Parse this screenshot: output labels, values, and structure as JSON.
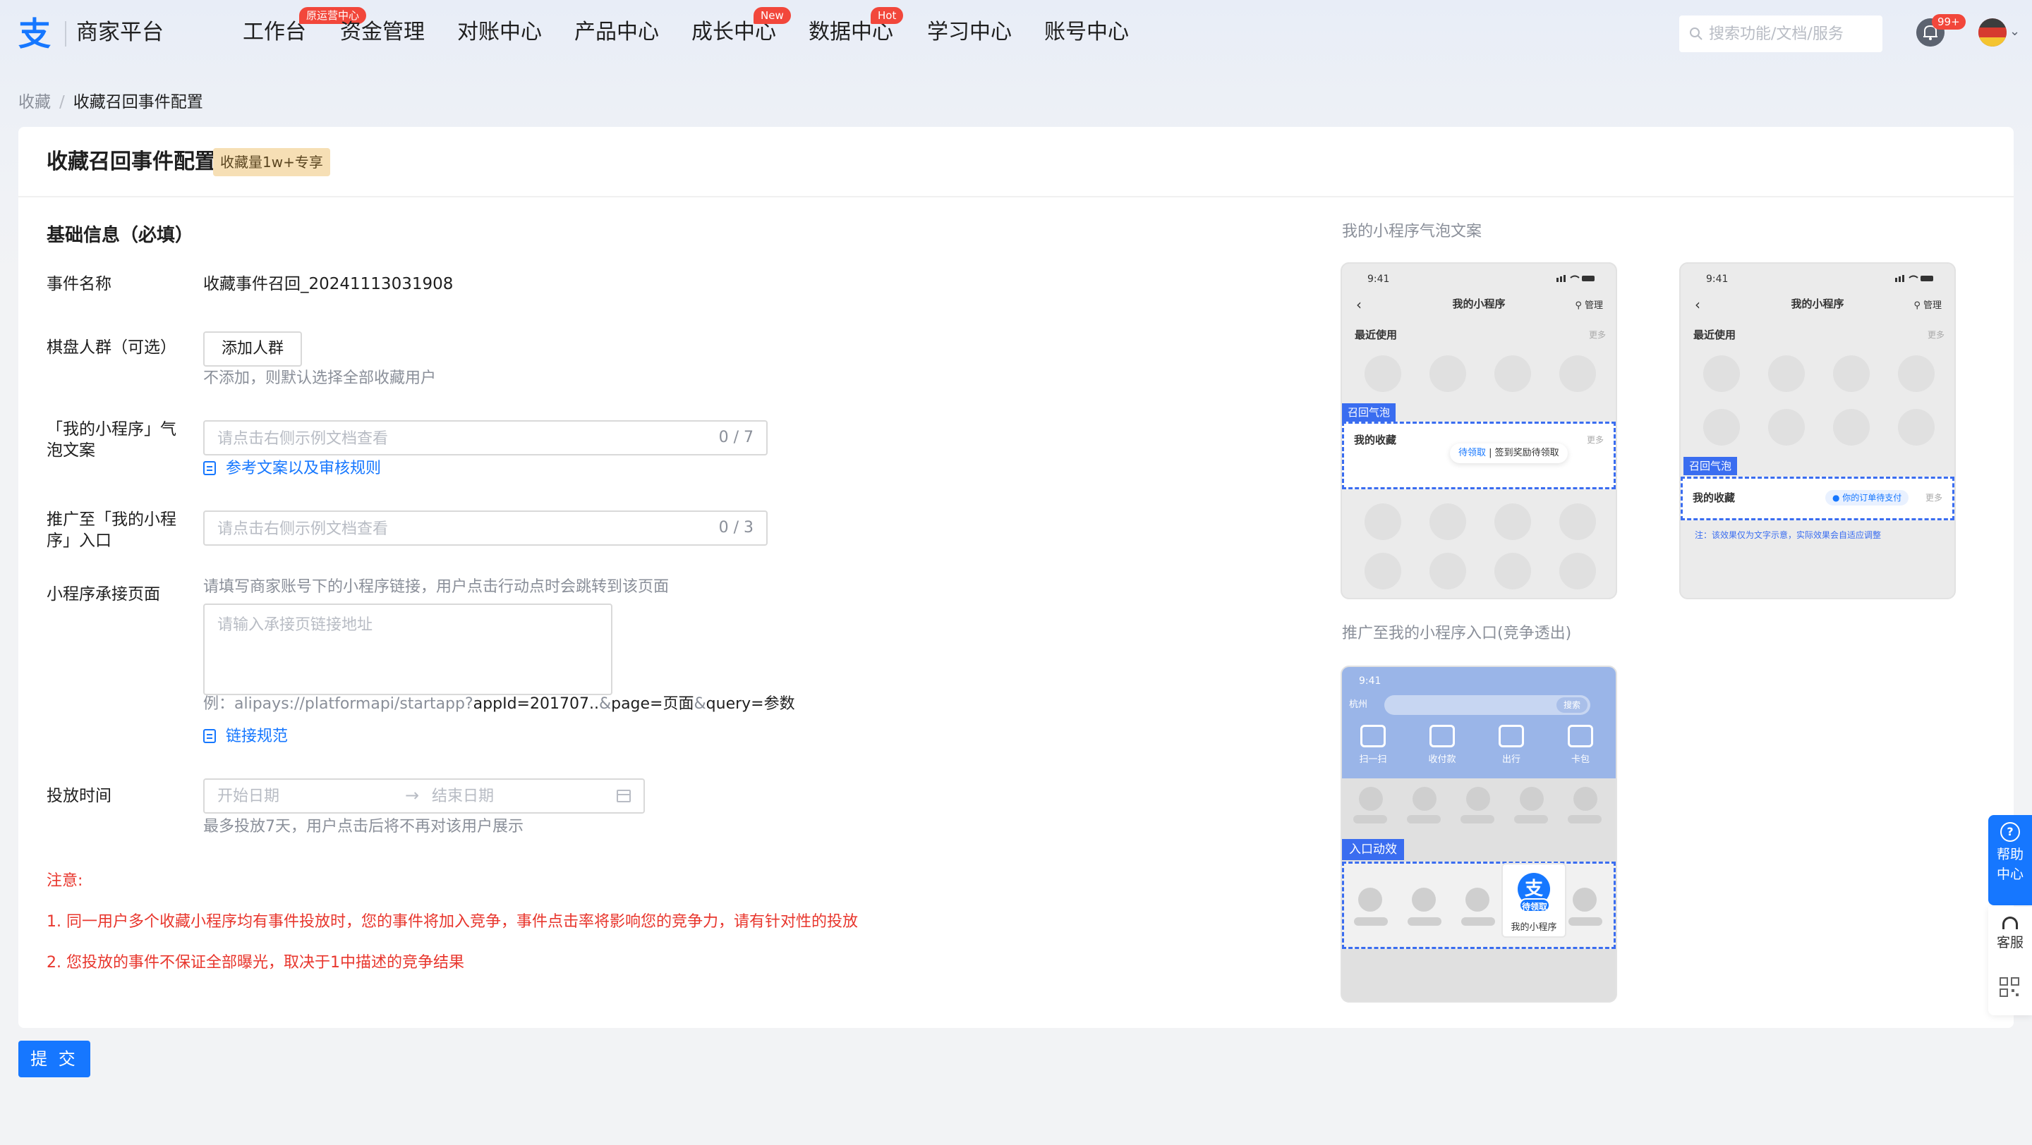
{
  "brand": {
    "name": "商家平台"
  },
  "nav": {
    "items": [
      {
        "label": "工作台",
        "badge": "原运营中心"
      },
      {
        "label": "资金管理",
        "badge": ""
      },
      {
        "label": "对账中心",
        "badge": ""
      },
      {
        "label": "产品中心",
        "badge": ""
      },
      {
        "label": "成长中心",
        "badge": "New"
      },
      {
        "label": "数据中心",
        "badge": "Hot"
      },
      {
        "label": "学习中心",
        "badge": ""
      },
      {
        "label": "账号中心",
        "badge": ""
      }
    ]
  },
  "header": {
    "search_placeholder": "搜索功能/文档/服务",
    "notification_count": "99+"
  },
  "breadcrumb": {
    "parent": "收藏",
    "separator": "/",
    "current": "收藏召回事件配置"
  },
  "page": {
    "title": "收藏召回事件配置",
    "tag": "收藏量1w+专享"
  },
  "form": {
    "section_title": "基础信息（必填）",
    "event_name": {
      "label": "事件名称",
      "value": "收藏事件召回_20241113031908"
    },
    "audience": {
      "label": "棋盘人群（可选）",
      "button": "添加人群",
      "hint": "不添加，则默认选择全部收藏用户"
    },
    "bubble_copy": {
      "label": "「我的小程序」气泡文案",
      "placeholder": "请点击右侧示例文档查看",
      "counter": "0 / 7",
      "link": "参考文案以及审核规则"
    },
    "promote_entry": {
      "label": "推广至「我的小程序」入口",
      "placeholder": "请点击右侧示例文档查看",
      "counter": "0 / 3"
    },
    "landing_page": {
      "label": "小程序承接页面",
      "hint": "请填写商家账号下的小程序链接，用户点击行动点时会跳转到该页面",
      "placeholder": "请输入承接页链接地址",
      "example_parts": [
        "例：",
        "alipays://platformapi/startapp?",
        "appId=201707..",
        "&",
        "page=页面",
        "&",
        "query=参数"
      ],
      "link": "链接规范"
    },
    "schedule": {
      "label": "投放时间",
      "start_placeholder": "开始日期",
      "end_placeholder": "结束日期",
      "hint": "最多投放7天，用户点击后将不再对该用户展示"
    },
    "notes": {
      "title": "注意:",
      "items": [
        "1. 同一用户多个收藏小程序均有事件投放时，您的事件将加入竞争，事件点击率将影响您的竞争力，请有针对性的投放",
        "2. 您投放的事件不保证全部曝光，取决于1中描述的竞争结果"
      ]
    },
    "submit_label": "提 交"
  },
  "preview": {
    "bubble_title": "我的小程序气泡文案",
    "entry_title": "推广至我的小程序入口(竞争透出)",
    "phone": {
      "time": "9:41",
      "title": "我的小程序",
      "manage": "管理",
      "recent": "最近使用",
      "more": "更多",
      "recall_tag": "召回气泡",
      "favorites": "我的收藏",
      "bubble_claim": "待领取",
      "bubble_text": "签到奖励待领取",
      "chip_text": "你的订单待支付",
      "note": "注：该效果仅为文字示意，实际效果会自适应调整"
    },
    "home": {
      "time": "9:41",
      "city": "杭州",
      "search_btn": "搜索",
      "icons": [
        "扫一扫",
        "收付款",
        "出行",
        "卡包"
      ],
      "tag": "入口动效",
      "app_badge": "待领取",
      "app_name": "我的小程序"
    }
  },
  "float": {
    "help": "帮助中心",
    "service": "客服"
  },
  "colors": {
    "primary": "#1677ff",
    "danger": "#e8362d",
    "badge": "#f2473b",
    "tag_bg": "#f6dfb5",
    "highlight": "#3a6df0"
  }
}
